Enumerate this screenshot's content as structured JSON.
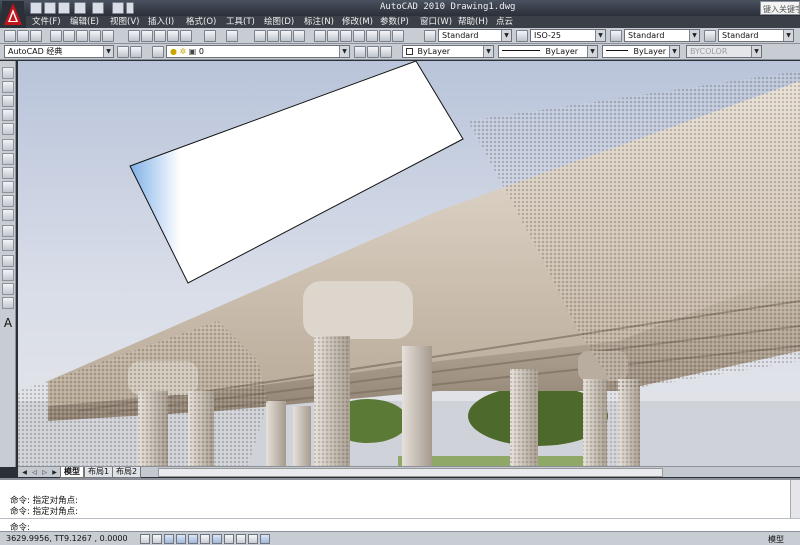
{
  "window": {
    "title": "AutoCAD 2010   Drawing1.dwg",
    "search_placeholder": "键入关键字"
  },
  "menu": [
    "文件(F)",
    "编辑(E)",
    "视图(V)",
    "插入(I)",
    "格式(O)",
    "工具(T)",
    "绘图(D)",
    "标注(N)",
    "修改(M)",
    "参数(P)",
    "窗口(W)",
    "帮助(H)",
    "点云"
  ],
  "styles": {
    "text_style": "Standard",
    "dim_style": "ISO-25",
    "table_style": "Standard",
    "multileader_style": "Standard"
  },
  "workspace": "AutoCAD 经典",
  "layer": "0",
  "properties": {
    "color": "ByLayer",
    "linetype": "ByLayer",
    "lineweight": "ByLayer",
    "plot_style": "BYCOLOR"
  },
  "left_toolbar": {
    "text_tool_label": "A"
  },
  "tabs": {
    "model": "模型",
    "layout1": "布局1",
    "layout2": "布局2"
  },
  "command": {
    "history": [
      "命令: 指定对角点:",
      "命令: 指定对角点:"
    ],
    "prompt": "命令:"
  },
  "status": {
    "coordinates": "3629.9956, TT9.1267 , 0.0000",
    "space_label": "模型"
  },
  "colors": {
    "accent": "#c4141b",
    "viewport_sky": "#b9c4da"
  }
}
